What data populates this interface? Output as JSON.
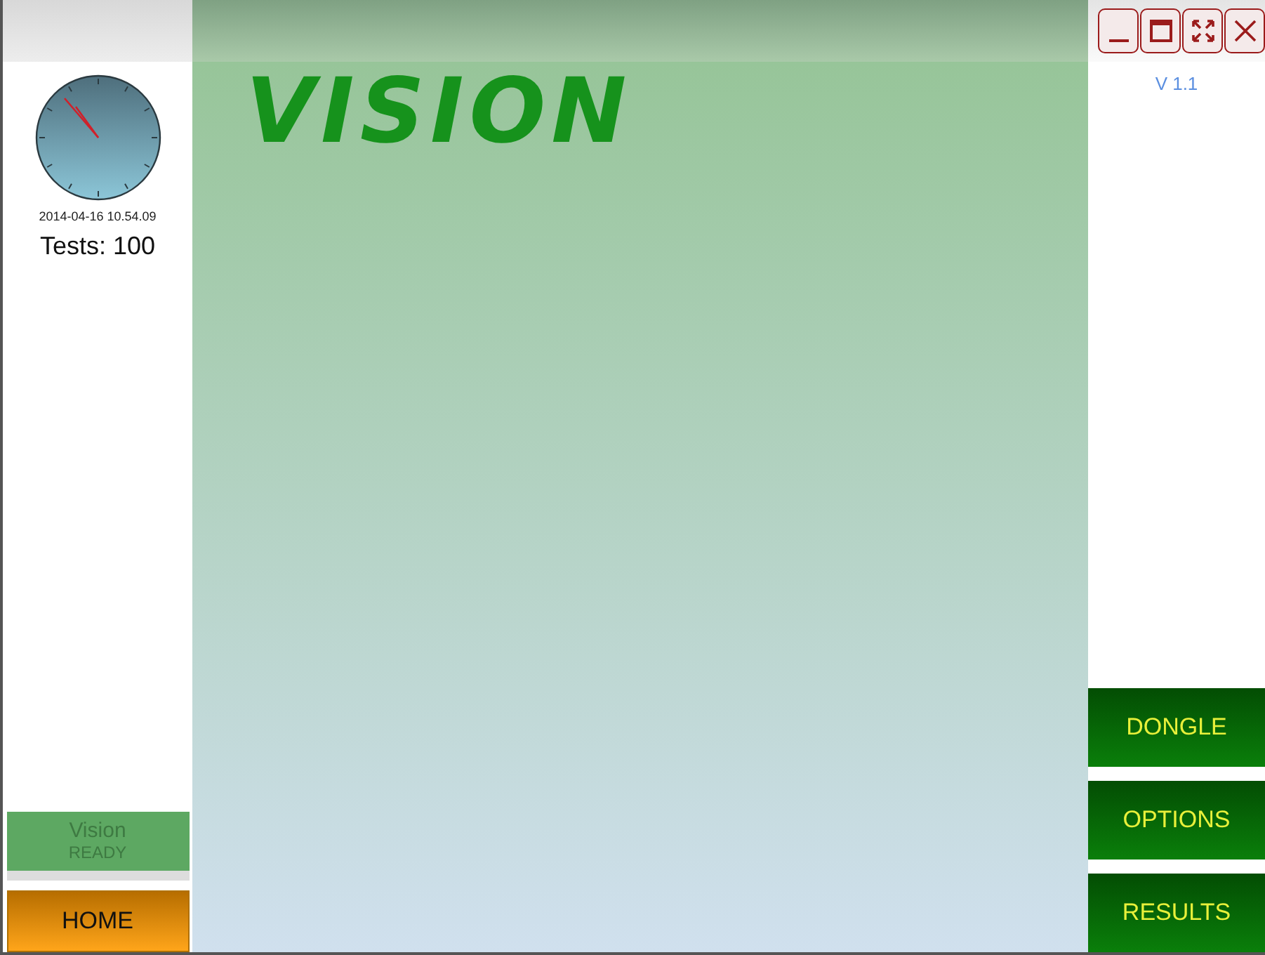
{
  "logo": "VISION",
  "clock": {
    "timestamp": "2014-04-16 10.54.09"
  },
  "tests": "Tests: 100",
  "version": "V 1.1",
  "status": {
    "name": "Vision",
    "state": "READY"
  },
  "home_button": "HOME",
  "window_buttons": [
    {
      "kind": "minimize"
    },
    {
      "kind": "maximize"
    },
    {
      "kind": "fullscreen"
    },
    {
      "kind": "close"
    }
  ],
  "side_buttons": [
    "DONGLE",
    "OPTIONS",
    "RESULTS"
  ]
}
